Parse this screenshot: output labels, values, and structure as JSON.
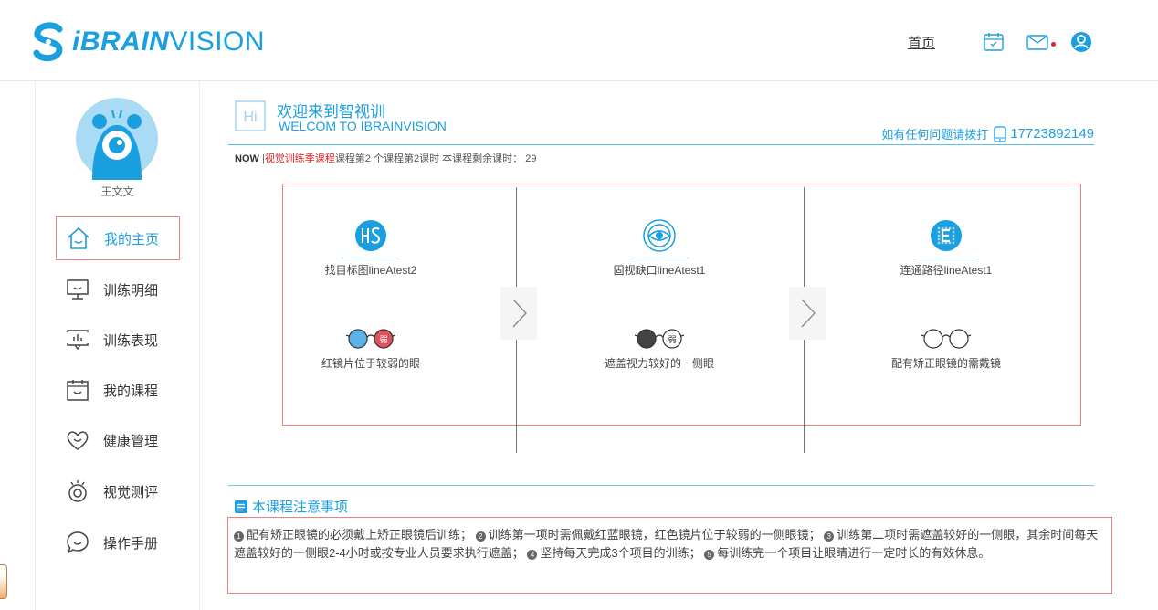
{
  "header": {
    "logo_bold": "iBRAIN",
    "logo_light": "VISION",
    "nav_home": "首页",
    "icons": [
      "calendar-icon",
      "mail-icon",
      "user-icon"
    ]
  },
  "user": {
    "name": "王文文"
  },
  "sidebar": {
    "items": [
      {
        "label": "我的主页",
        "icon": "home-icon",
        "active": true
      },
      {
        "label": "训练明细",
        "icon": "monitor-icon"
      },
      {
        "label": "训练表现",
        "icon": "chart-screen-icon"
      },
      {
        "label": "我的课程",
        "icon": "calendar-icon"
      },
      {
        "label": "健康管理",
        "icon": "heart-icon"
      },
      {
        "label": "视觉测评",
        "icon": "eye-icon"
      },
      {
        "label": "操作手册",
        "icon": "chat-icon"
      }
    ]
  },
  "welcome": {
    "badge": "Hi",
    "title_cn": "欢迎来到智视训",
    "title_en": "WELCOM TO IBRAINVISION",
    "hotline_label": "如有任何问题请拨打",
    "hotline_number": "17723892149"
  },
  "now": {
    "label": "NOW",
    "sep": "|",
    "course_name": "视觉训练季课程",
    "detail": "课程第2 个课程第2课时 本课程剩余课时：  29"
  },
  "cards": [
    {
      "name": "找目标图lineAtest2",
      "glasses_text": "红镜片位于较弱的眼",
      "glasses_badge": "弱"
    },
    {
      "name": "固视缺口lineAtest1",
      "glasses_text": "遮盖视力较好的一侧眼",
      "glasses_badge": "弱"
    },
    {
      "name": "连通路径lineAtest1",
      "glasses_text": "配有矫正眼镜的需戴镜"
    }
  ],
  "notice": {
    "title": "本课程注意事项",
    "items": [
      {
        "num": "1",
        "text": "配有矫正眼镜的必须戴上矫正眼镜后训练；"
      },
      {
        "num": "2",
        "text": "训练第一项时需佩戴红蓝眼镜，红色镜片位于较弱的一侧眼镜；"
      },
      {
        "num": "3",
        "text": "训练第二项时需遮盖较好的一侧眼，其余时间每天遮盖较好的一侧眼2-4小时或按专业人员要求执行遮盖；"
      },
      {
        "num": "4",
        "text": "坚持每天完成3个项目的训练；"
      },
      {
        "num": "5",
        "text": "每训练完一个项目让眼睛进行一定时长的有效休息。"
      }
    ]
  },
  "colors": {
    "brand": "#1a9fe0",
    "highlight_border": "#f08080",
    "alert": "#e02020"
  }
}
